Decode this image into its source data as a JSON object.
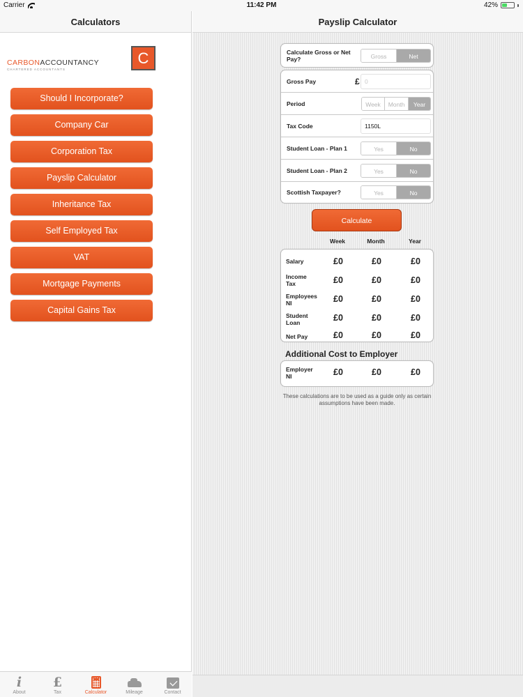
{
  "status": {
    "carrier": "Carrier",
    "time": "11:42 PM",
    "battery": "42%",
    "battery_level": 0.42,
    "battery_color": "#4cd964"
  },
  "left": {
    "title": "Calculators",
    "brand": {
      "part1": "CARBON",
      "part2": "ACCOUNTANCY",
      "tagline": "CHARTERED ACCOUNTANTS",
      "logo_letter": "C",
      "accent": "#e8582a"
    },
    "menu": [
      "Should I Incorporate?",
      "Company Car",
      "Corporation Tax",
      "Payslip Calculator",
      "Inheritance Tax",
      "Self Employed Tax",
      "VAT",
      "Mortgage Payments",
      "Capital Gains Tax"
    ],
    "tabs": [
      {
        "label": "About",
        "icon": "info-icon",
        "glyph": "i"
      },
      {
        "label": "Tax",
        "icon": "pound-icon",
        "glyph": "£"
      },
      {
        "label": "Calculator",
        "icon": "calculator-icon"
      },
      {
        "label": "Mileage",
        "icon": "car-icon"
      },
      {
        "label": "Contact",
        "icon": "mail-icon"
      }
    ]
  },
  "right": {
    "title": "Payslip Calculator",
    "form": {
      "gross_net_label": "Calculate Gross or Net Pay?",
      "gross_net_options": [
        "Gross",
        "Net"
      ],
      "gross_pay_label": "Gross Pay",
      "currency": "£",
      "gross_pay_placeholder": "0",
      "period_label": "Period",
      "period_options": [
        "Week",
        "Month",
        "Year"
      ],
      "tax_code_label": "Tax Code",
      "tax_code_value": "1150L",
      "student_loan_1_label": "Student Loan - Plan 1",
      "student_loan_2_label": "Student Loan - Plan 2",
      "scottish_label": "Scottish Taxpayer?",
      "yes": "Yes",
      "no": "No"
    },
    "calculate_label": "Calculate",
    "columns": [
      "Week",
      "Month",
      "Year"
    ],
    "results": [
      {
        "label_line1": "Salary",
        "label_line2": "",
        "values": [
          "£0",
          "£0",
          "£0"
        ]
      },
      {
        "label_line1": "Income",
        "label_line2": "Tax",
        "values": [
          "£0",
          "£0",
          "£0"
        ]
      },
      {
        "label_line1": "Employees",
        "label_line2": "NI",
        "values": [
          "£0",
          "£0",
          "£0"
        ]
      },
      {
        "label_line1": "Student",
        "label_line2": "Loan",
        "values": [
          "£0",
          "£0",
          "£0"
        ]
      },
      {
        "label_line1": "Net Pay",
        "label_line2": "",
        "values": [
          "£0",
          "£0",
          "£0"
        ]
      }
    ],
    "employer_title": "Additional Cost to Employer",
    "employer_row": {
      "label_line1": "Employer",
      "label_line2": "NI",
      "values": [
        "£0",
        "£0",
        "£0"
      ]
    },
    "disclaimer": "These calculations are to be used as a guide only as certain assumptions have been made."
  }
}
